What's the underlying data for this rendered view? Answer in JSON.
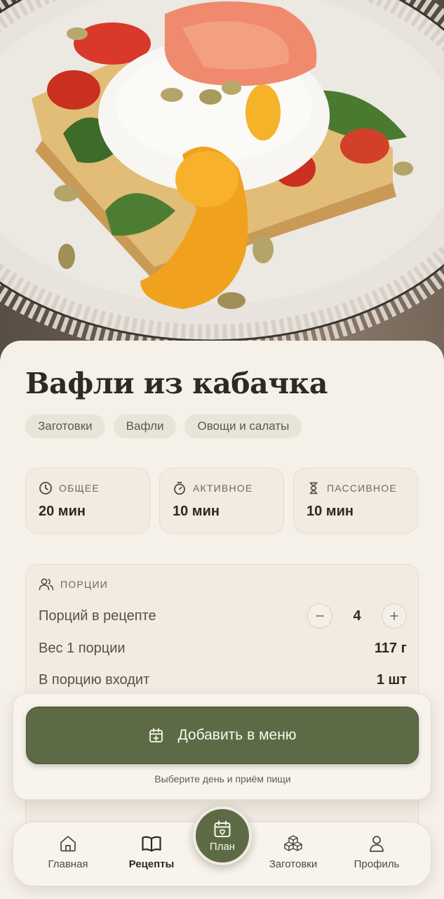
{
  "recipe": {
    "title": "Вафли из кабачка",
    "tags": [
      "Заготовки",
      "Вафли",
      "Овощи и салаты"
    ]
  },
  "times": [
    {
      "icon": "clock-icon",
      "label": "ОБЩЕЕ",
      "value": "20 мин"
    },
    {
      "icon": "stopwatch-icon",
      "label": "АКТИВНОЕ",
      "value": "10 мин"
    },
    {
      "icon": "hourglass-icon",
      "label": "ПАССИВНОЕ",
      "value": "10 мин"
    }
  ],
  "portions": {
    "header": "ПОРЦИИ",
    "servings_label": "Порций в рецепте",
    "servings_value": "4",
    "weight_label": "Вес 1 порции",
    "weight_value": "117 г",
    "contains_label": "В порцию входит",
    "contains_value": "1 шт"
  },
  "add_to_menu": {
    "button_label": "Добавить в меню",
    "hint": "Выберите день и приём пищи"
  },
  "nav": {
    "items": [
      {
        "label": "Главная",
        "icon": "home-icon"
      },
      {
        "label": "Рецепты",
        "icon": "book-icon"
      },
      {
        "label": "План",
        "icon": "calendar-heart-icon"
      },
      {
        "label": "Заготовки",
        "icon": "cubes-icon"
      },
      {
        "label": "Профиль",
        "icon": "user-icon"
      }
    ],
    "active": "Рецепты"
  },
  "colors": {
    "accent": "#5c6b45",
    "background": "#f5f0e8",
    "card": "#f1ebe2",
    "tag": "#e9e4d8"
  }
}
